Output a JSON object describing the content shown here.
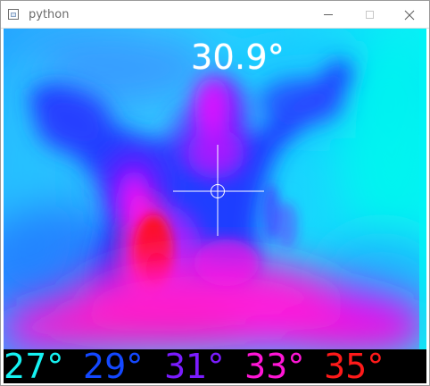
{
  "window": {
    "title": "python",
    "icon": "python-app-icon",
    "controls": {
      "minimize": "minimize-icon",
      "maximize": "maximize-icon",
      "close": "close-icon"
    }
  },
  "overlay": {
    "temperature": "30.9°"
  },
  "legend": [
    {
      "label": "27°",
      "color": "#16f2f2"
    },
    {
      "label": "29°",
      "color": "#1448ff"
    },
    {
      "label": "31°",
      "color": "#7b1cff"
    },
    {
      "label": "33°",
      "color": "#ff16d6"
    },
    {
      "label": "35°",
      "color": "#ff1a1a"
    }
  ],
  "colors": {
    "cool": "#16f2f2",
    "mid_cool": "#1448ff",
    "mid": "#7b1cff",
    "warm": "#ff16d6",
    "hot": "#ff1a1a"
  }
}
